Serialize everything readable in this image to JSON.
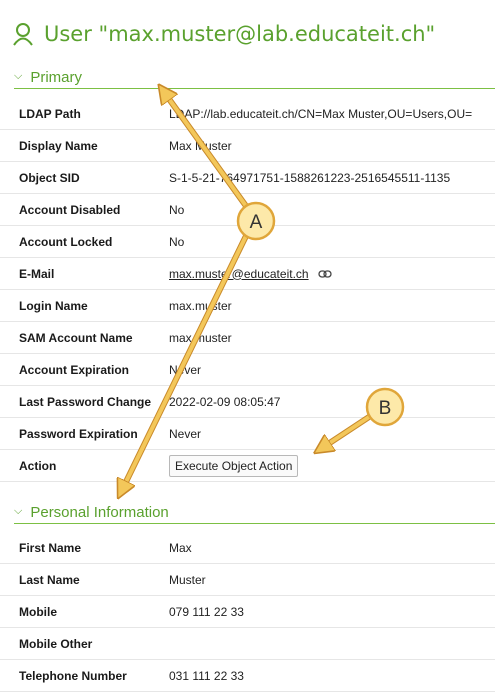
{
  "header": {
    "title": "User \"max.muster@lab.educateit.ch\"",
    "icon": "user-icon"
  },
  "sections": {
    "primary": {
      "title": "Primary"
    },
    "personal": {
      "title": "Personal Information"
    }
  },
  "primary_rows": {
    "ldap_path": {
      "label": "LDAP Path",
      "value": "LDAP://lab.educateit.ch/CN=Max Muster,OU=Users,OU="
    },
    "display_name": {
      "label": "Display Name",
      "value": "Max Muster"
    },
    "object_sid": {
      "label": "Object SID",
      "value": "S-1-5-21-764971751-1588261223-2516545511-1135"
    },
    "account_disabled": {
      "label": "Account Disabled",
      "value": "No"
    },
    "account_locked": {
      "label": "Account Locked",
      "value": "No"
    },
    "email": {
      "label": "E-Mail",
      "value": "max.muster@educateit.ch"
    },
    "login_name": {
      "label": "Login Name",
      "value": "max.muster"
    },
    "sam_account_name": {
      "label": "SAM Account Name",
      "value": "max.muster"
    },
    "account_expiration": {
      "label": "Account Expiration",
      "value": "Never"
    },
    "last_password_change": {
      "label": "Last Password Change",
      "value": "2022-02-09 08:05:47"
    },
    "password_expiration": {
      "label": "Password Expiration",
      "value": "Never"
    },
    "action": {
      "label": "Action",
      "button": "Execute Object Action"
    }
  },
  "personal_rows": {
    "first_name": {
      "label": "First Name",
      "value": "Max"
    },
    "last_name": {
      "label": "Last Name",
      "value": "Muster"
    },
    "mobile": {
      "label": "Mobile",
      "value": "079 111 22 33"
    },
    "mobile_other": {
      "label": "Mobile Other",
      "value": ""
    },
    "telephone_number": {
      "label": "Telephone Number",
      "value": "031 111 22 33"
    }
  },
  "callouts": {
    "a": {
      "letter": "A"
    },
    "b": {
      "letter": "B"
    }
  },
  "colors": {
    "accent": "#5aa12e",
    "callout_fill": "#fde9a9",
    "callout_stroke": "#e0a63a"
  }
}
